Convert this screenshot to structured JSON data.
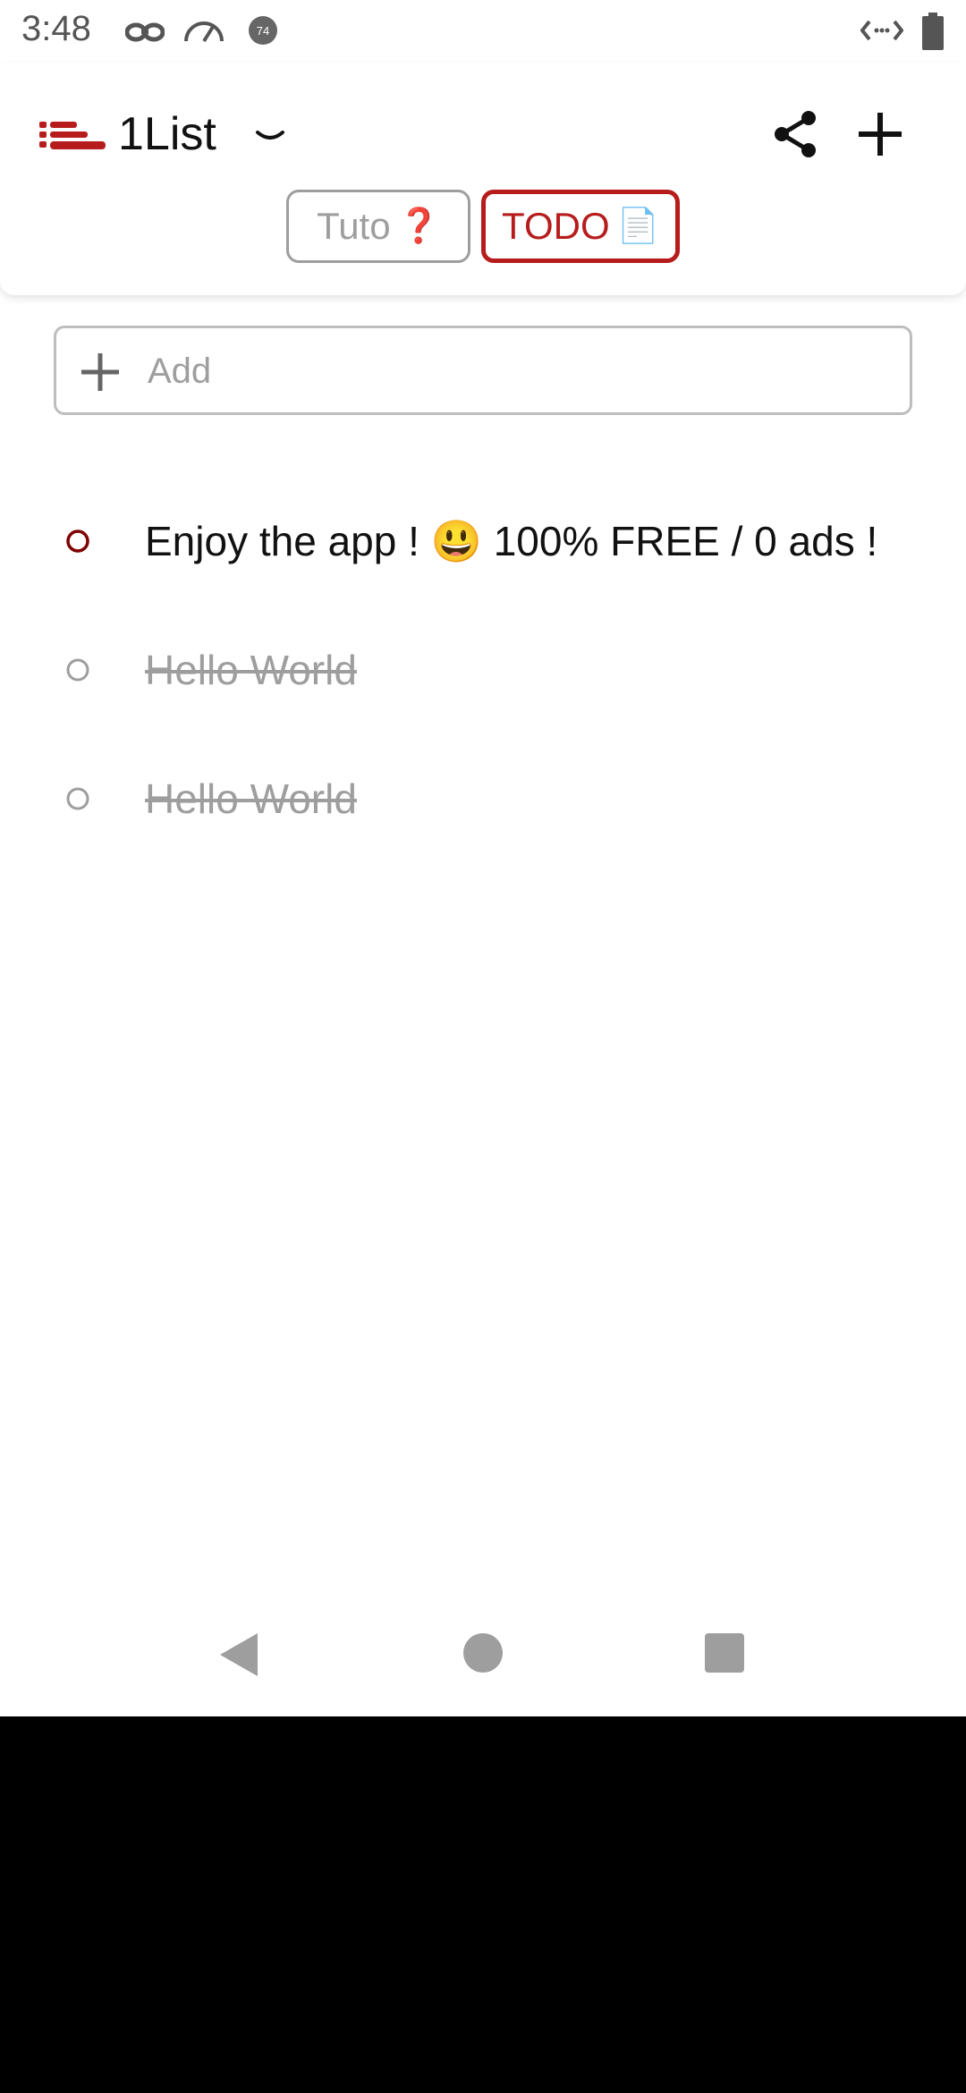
{
  "status_bar": {
    "time": "3:48",
    "left_icons": [
      "incognito-icon",
      "speedometer-icon",
      "notification-count-icon"
    ],
    "notification_count": "74",
    "right_icons": [
      "data-saver-icon",
      "battery-icon"
    ]
  },
  "app_bar": {
    "title": "1List",
    "logo_icon": "list-logo-icon",
    "dropdown_icon": "chevron-down-icon",
    "actions": [
      "share-icon",
      "plus-icon"
    ]
  },
  "tabs": [
    {
      "label": "Tuto",
      "emoji": "❓",
      "selected": false
    },
    {
      "label": "TODO",
      "emoji": "📄",
      "selected": true
    }
  ],
  "add_field": {
    "placeholder": "Add",
    "value": ""
  },
  "items": [
    {
      "text": "Enjoy the app ! 😃 100% FREE / 0 ads !",
      "done": false
    },
    {
      "text": "Hello World",
      "done": true
    },
    {
      "text": "Hello World",
      "done": true
    }
  ],
  "nav_bar": [
    "back-icon",
    "home-icon",
    "recents-icon"
  ],
  "colors": {
    "accent": "#b71c1c",
    "done_text": "#9e9e9e",
    "background": "#ffffff"
  }
}
